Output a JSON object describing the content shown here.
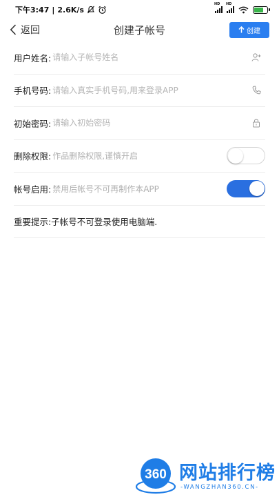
{
  "status_bar": {
    "time": "下午3:47",
    "speed": "2.6K/s",
    "icons": [
      "mute-icon",
      "alarm-icon",
      "signal-icon",
      "wifi-icon",
      "battery-icon"
    ],
    "battery_color": "#39b54a"
  },
  "nav": {
    "back_label": "返回",
    "title": "创建子帐号",
    "create_label": "创建",
    "accent_color": "#2a7ef0"
  },
  "form": {
    "name": {
      "label": "用户姓名:",
      "placeholder": "请输入子帐号姓名",
      "icon": "add-user-icon"
    },
    "phone": {
      "label": "手机号码:",
      "placeholder": "请输入真实手机号码,用来登录APP",
      "icon": "phone-icon"
    },
    "password": {
      "label": "初始密码:",
      "placeholder": "请输入初始密码",
      "icon": "lock-icon"
    },
    "delete_perm": {
      "label": "删除权限:",
      "hint": "作品删除权限,谨慎开启",
      "enabled": false
    },
    "account_enable": {
      "label": "帐号启用:",
      "hint": "禁用后帐号不可再制作本APP",
      "enabled": true
    }
  },
  "notice": "重要提示:子帐号不可登录使用电脑端.",
  "watermark": {
    "logo_text": "360",
    "site_name": "网站排行榜",
    "url": "-WANGZHAN360.CN-"
  }
}
